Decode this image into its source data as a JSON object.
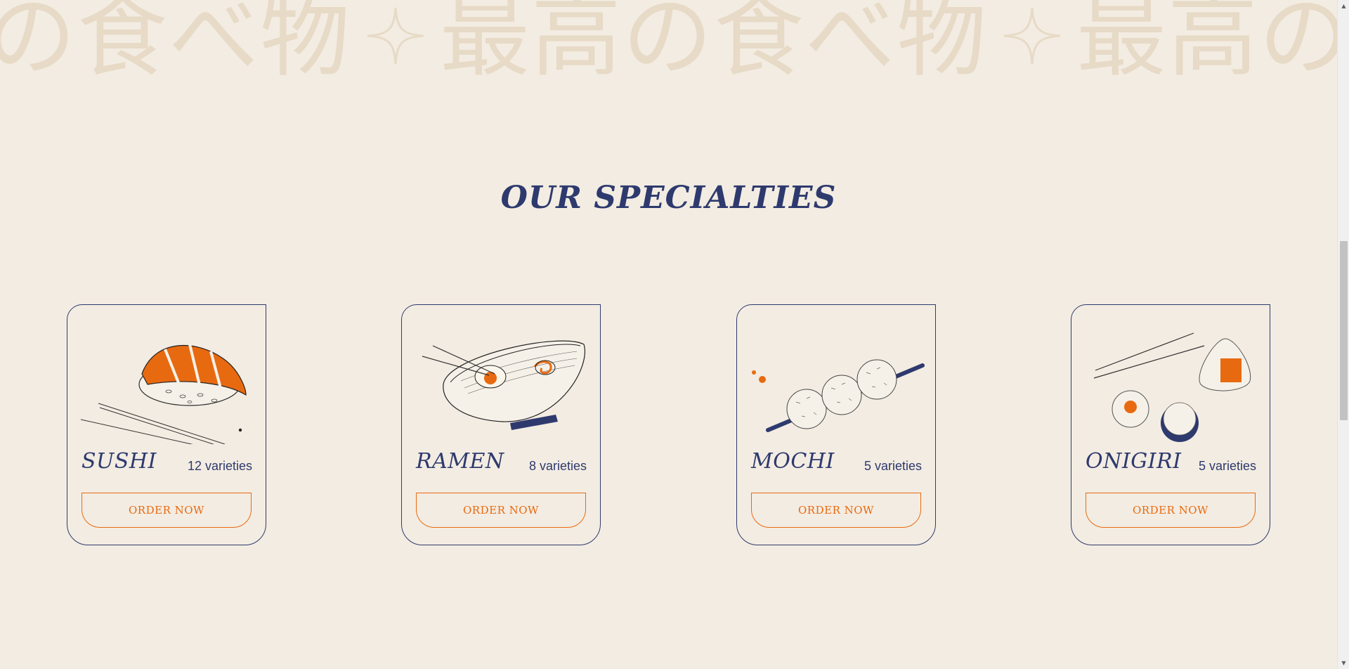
{
  "marquee": {
    "items": [
      "の食べ物",
      "最高の食べ物",
      "最高の食"
    ]
  },
  "section": {
    "title": "OUR SPECIALTIES"
  },
  "cards": [
    {
      "name": "SUSHI",
      "count": "12 varieties",
      "button": "ORDER NOW",
      "icon": "sushi-illustration"
    },
    {
      "name": "RAMEN",
      "count": "8 varieties",
      "button": "ORDER NOW",
      "icon": "ramen-illustration"
    },
    {
      "name": "MOCHI",
      "count": "5 varieties",
      "button": "ORDER NOW",
      "icon": "mochi-illustration"
    },
    {
      "name": "ONIGIRI",
      "count": "5 varieties",
      "button": "ORDER NOW",
      "icon": "onigiri-illustration"
    }
  ],
  "colors": {
    "background": "#f3ece2",
    "navy": "#2e3a6e",
    "orange": "#e86a10",
    "marquee": "#e7dac6"
  },
  "scrollbar": {
    "up_icon": "▲",
    "down_icon": "▼"
  }
}
